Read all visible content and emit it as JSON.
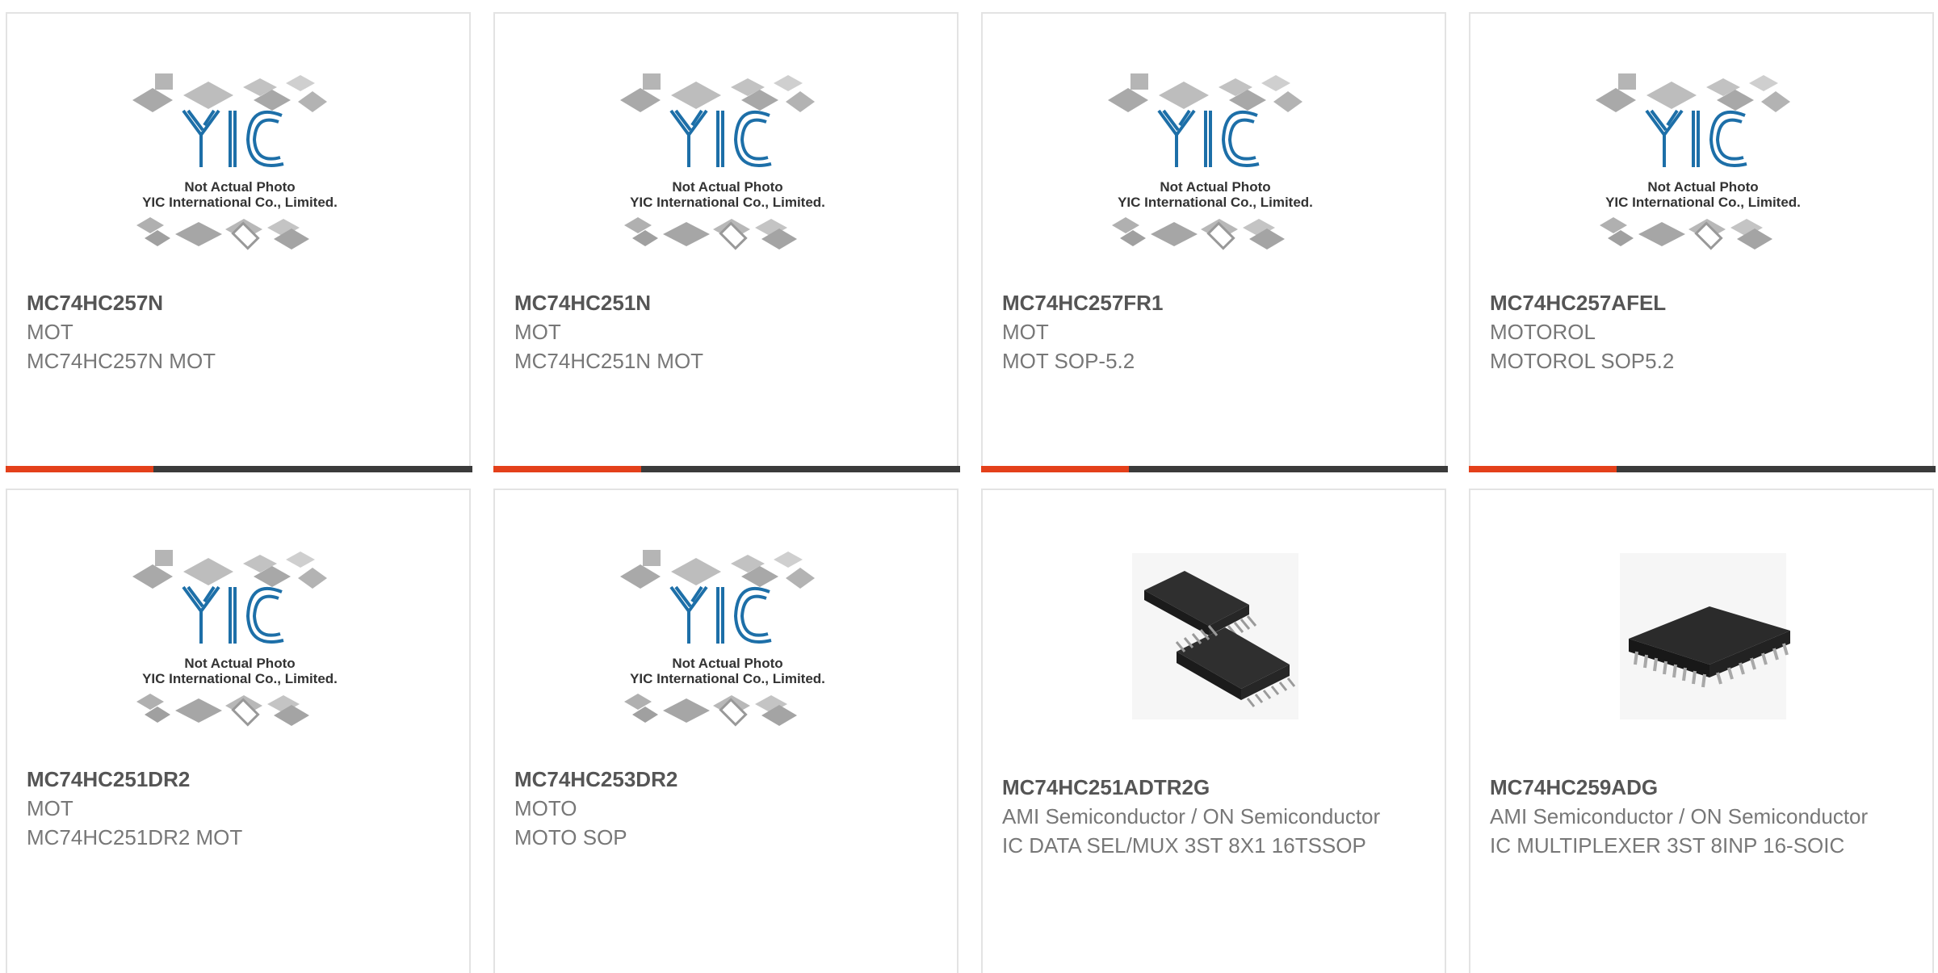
{
  "placeholder_image": {
    "line1": "Not Actual Photo",
    "line2": "YIC International Co., Limited.",
    "logo": "YIC"
  },
  "products": [
    {
      "part": "MC74HC257N",
      "mfr": "MOT",
      "desc": "MC74HC257N MOT",
      "image": "placeholder"
    },
    {
      "part": "MC74HC251N",
      "mfr": "MOT",
      "desc": "MC74HC251N MOT",
      "image": "placeholder"
    },
    {
      "part": "MC74HC257FR1",
      "mfr": "MOT",
      "desc": "MOT SOP-5.2",
      "image": "placeholder"
    },
    {
      "part": "MC74HC257AFEL",
      "mfr": "MOTOROL",
      "desc": "MOTOROL SOP5.2",
      "image": "placeholder"
    },
    {
      "part": "MC74HC251DR2",
      "mfr": "MOT",
      "desc": "MC74HC251DR2 MOT",
      "image": "placeholder"
    },
    {
      "part": "MC74HC253DR2",
      "mfr": "MOTO",
      "desc": "MOTO SOP",
      "image": "placeholder"
    },
    {
      "part": "MC74HC251ADTR2G",
      "mfr": "AMI Semiconductor / ON Semiconductor",
      "desc": "IC DATA SEL/MUX 3ST 8X1 16TSSOP",
      "image": "tssop-chip-photo"
    },
    {
      "part": "MC74HC259ADG",
      "mfr": "AMI Semiconductor / ON Semiconductor",
      "desc": "IC MULTIPLEXER 3ST 8INP 16-SOIC",
      "image": "soic-chip-photo"
    }
  ],
  "colors": {
    "accent": "#e4401a",
    "bar": "#3b3b3b",
    "logo": "#1d6fa8"
  }
}
